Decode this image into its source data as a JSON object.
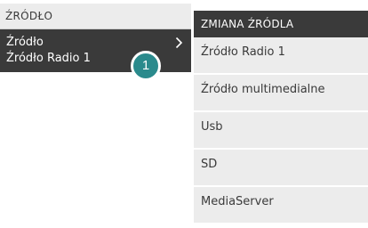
{
  "left_panel": {
    "header": "ŹRÓDŁO",
    "selected_item": {
      "label": "Źródło",
      "value": "Źródło Radio 1",
      "chevron_icon": "chevron-right-icon"
    },
    "badge_number": "1"
  },
  "right_panel": {
    "header": "ZMIANA ŹRÓDLA",
    "items": [
      {
        "label": "Źródło Radio 1"
      },
      {
        "label": "Źródło multimedialne"
      },
      {
        "label": "Usb"
      },
      {
        "label": "SD"
      },
      {
        "label": "MediaServer"
      }
    ]
  },
  "colors": {
    "dark": "#3a3a3a",
    "light": "#ececec",
    "accent": "#2a8a8c",
    "text_dark": "#3a3a3a",
    "text_light": "#ffffff"
  }
}
